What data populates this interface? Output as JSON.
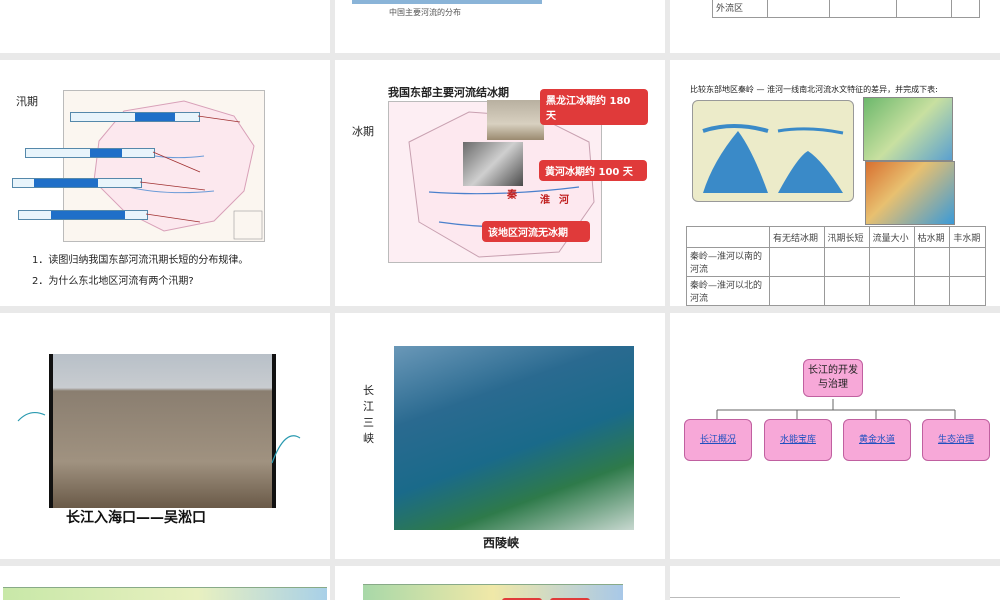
{
  "row1": {
    "slide1": {},
    "slide2": {
      "caption": "中国主要河流的分布"
    },
    "slide3": {
      "table_last_row": "外流区"
    }
  },
  "row2": {
    "flood": {
      "title": "汛期",
      "question1": "1．读图归纳我国东部河流汛期长短的分布规律。",
      "question2": "2．为什么东北地区河流有两个汛期?"
    },
    "ice": {
      "side_label": "冰期",
      "title": "我国东部主要河流结冰期",
      "label_heilong": "黑龙江冰期约 180 天",
      "label_huanghe": "黄河冰期约 100 天",
      "label_noice": "该地区河流无冰期",
      "map_qin": "秦",
      "map_huai": "淮",
      "map_he": "河"
    },
    "compare": {
      "intro": "比较东部地区秦岭 — 淮河一线南北河流水文特征的差异，并完成下表:",
      "headers": [
        "",
        "有无结冰期",
        "汛期长短",
        "流量大小",
        "枯水期",
        "丰水期"
      ],
      "rows": [
        "秦岭—淮河以南的河流",
        "秦岭—淮河以北的河流"
      ]
    }
  },
  "row3": {
    "estuary": {
      "caption": "长江入海口——吴淞口"
    },
    "gorges": {
      "side_label": "长江三峡",
      "caption": "西陵峡"
    },
    "mindmap": {
      "root": "长江的开发与治理",
      "children": [
        "长江概况",
        "水能宝库",
        "黄金水道",
        "生态治理"
      ]
    }
  },
  "colors": {
    "red_label": "#e03a3a",
    "pink_box": "#f7a8d8",
    "bar_blue": "#1f6fc8"
  }
}
